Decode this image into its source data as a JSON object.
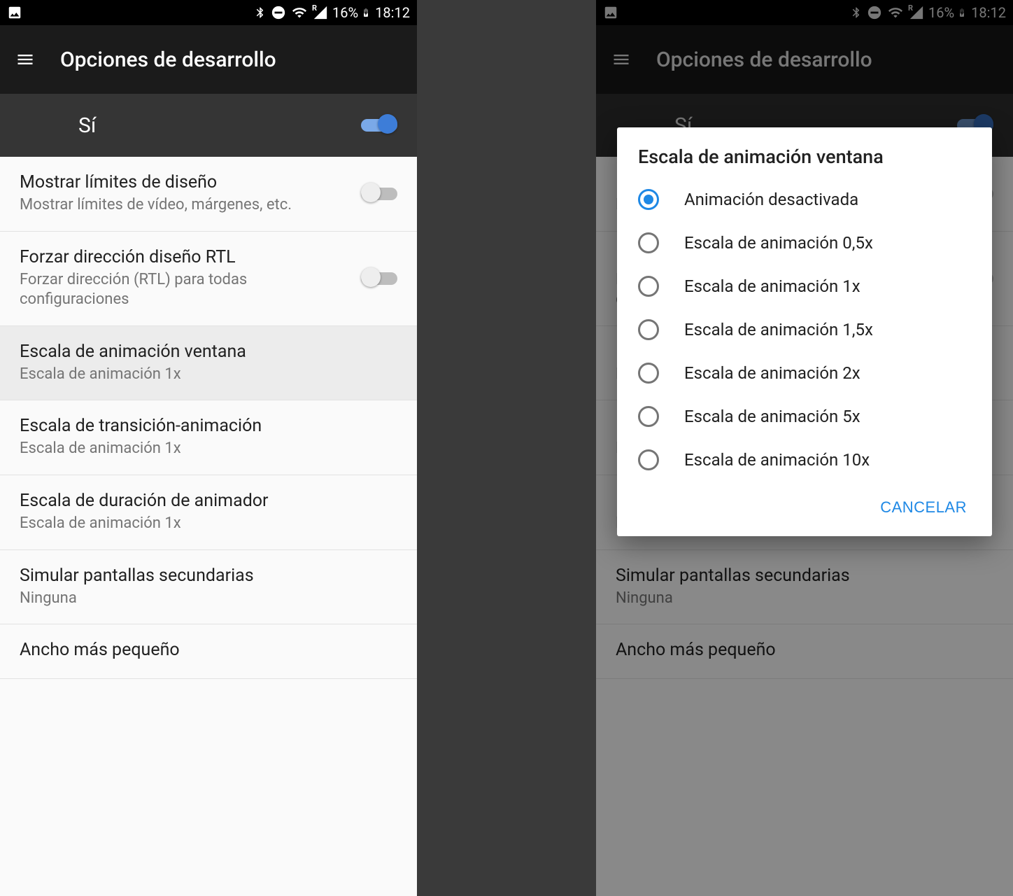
{
  "status": {
    "battery_pct": "16%",
    "time": "18:12",
    "roaming": "R"
  },
  "appbar": {
    "title": "Opciones de desarrollo"
  },
  "master": {
    "label": "Sí"
  },
  "settings": [
    {
      "title": "Mostrar límites de diseño",
      "sub": "Mostrar límites de vídeo, márgenes, etc.",
      "has_switch": true,
      "switch_on": false
    },
    {
      "title": "Forzar dirección diseño RTL",
      "sub": "Forzar dirección (RTL) para todas configuraciones",
      "has_switch": true,
      "switch_on": false
    },
    {
      "title": "Escala de animación ventana",
      "sub": "Escala de animación 1x",
      "has_switch": false,
      "selected": true
    },
    {
      "title": "Escala de transición-animación",
      "sub": "Escala de animación 1x",
      "has_switch": false
    },
    {
      "title": "Escala de duración de animador",
      "sub": "Escala de animación 1x",
      "has_switch": false
    },
    {
      "title": "Simular pantallas secundarias",
      "sub": "Ninguna",
      "has_switch": false
    },
    {
      "title": "Ancho más pequeño",
      "sub": "",
      "has_switch": false
    }
  ],
  "dialog": {
    "title": "Escala de animación ventana",
    "options": [
      {
        "label": "Animación desactivada",
        "checked": true
      },
      {
        "label": "Escala de animación 0,5x",
        "checked": false
      },
      {
        "label": "Escala de animación 1x",
        "checked": false
      },
      {
        "label": "Escala de animación 1,5x",
        "checked": false
      },
      {
        "label": "Escala de animación 2x",
        "checked": false
      },
      {
        "label": "Escala de animación 5x",
        "checked": false
      },
      {
        "label": "Escala de animación 10x",
        "checked": false
      }
    ],
    "cancel": "CANCELAR"
  }
}
